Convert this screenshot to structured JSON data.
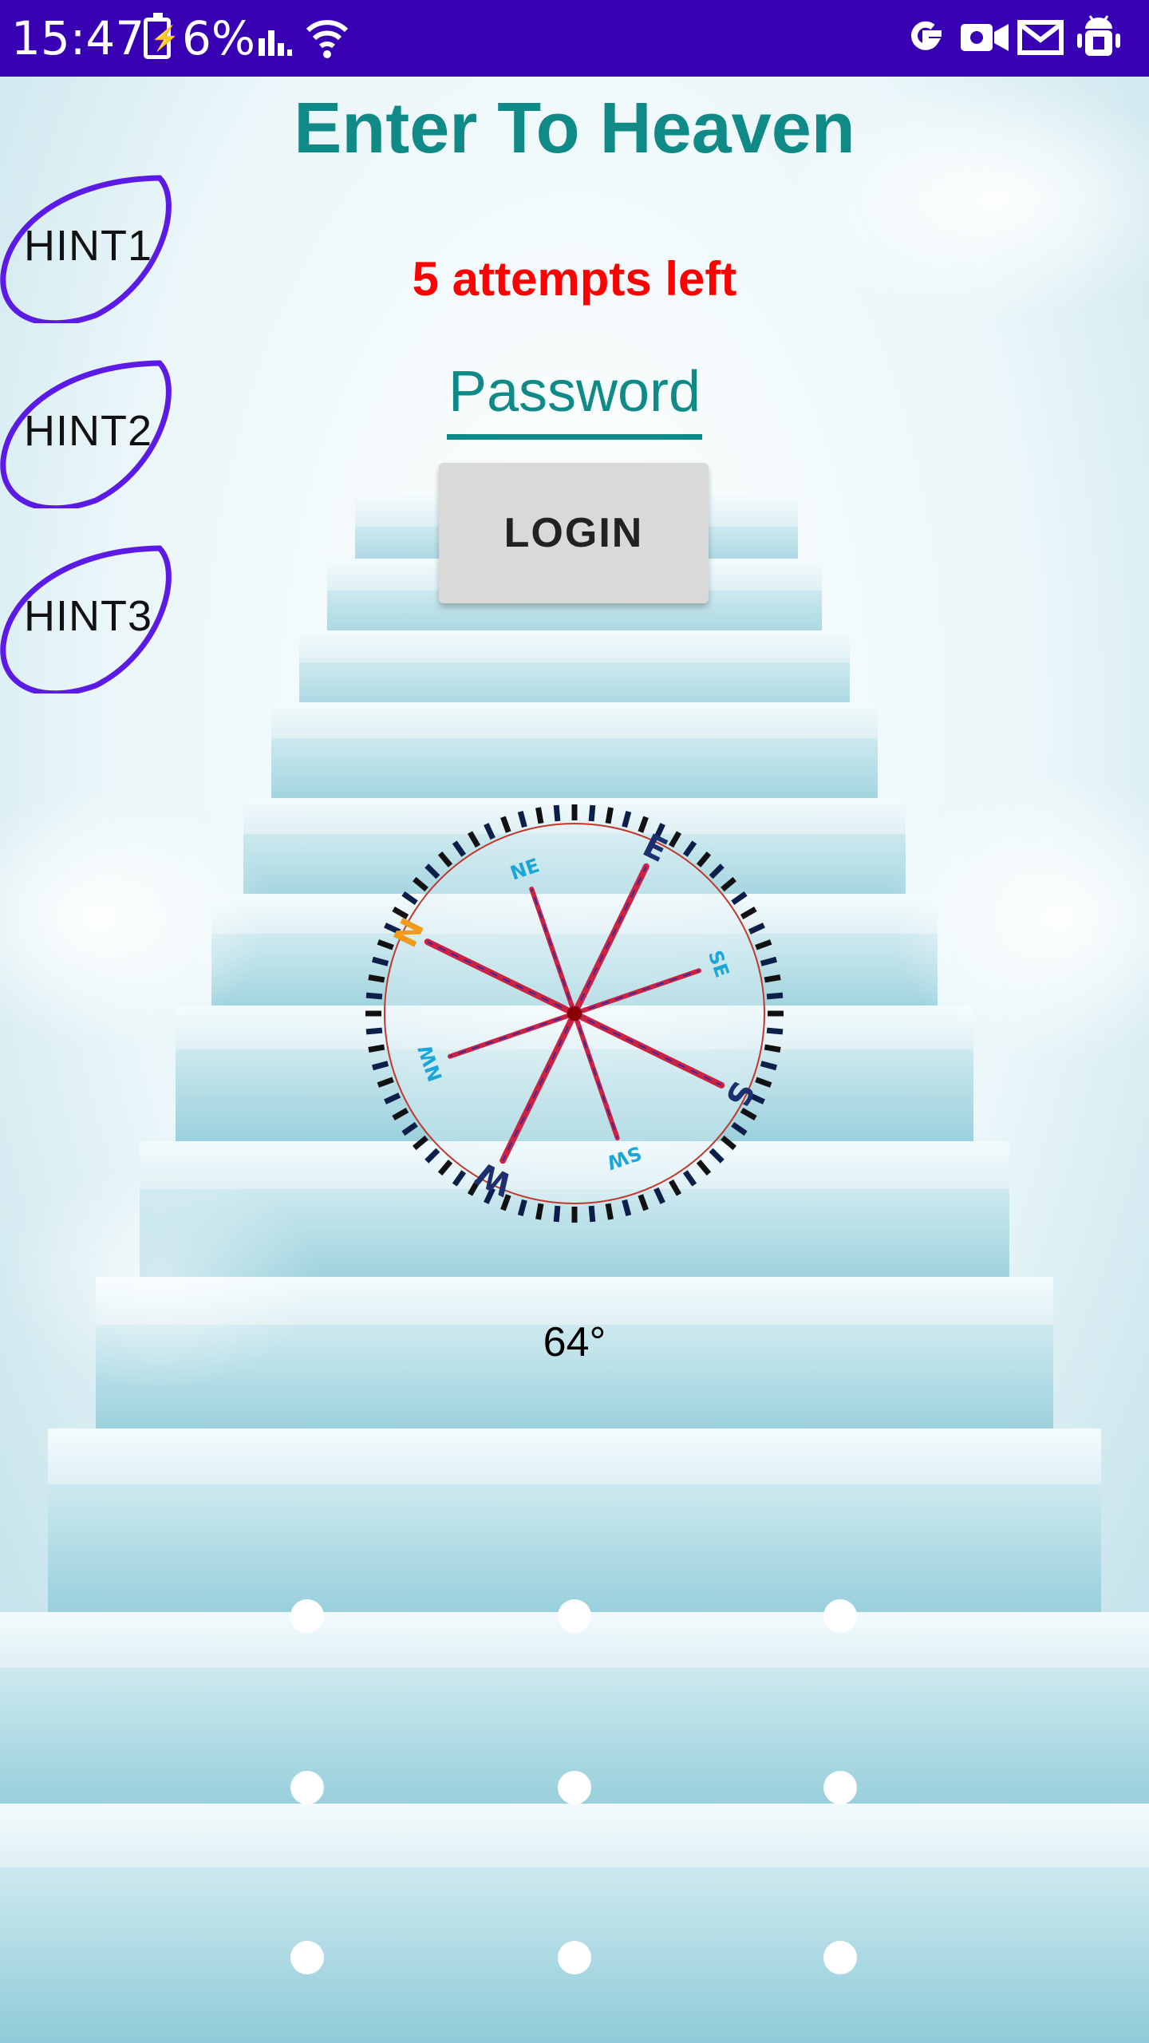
{
  "status_bar": {
    "time": "15:47",
    "battery_percent": "6%",
    "icons": [
      "battery-charging-icon",
      "signal-icon",
      "wifi-icon",
      "google-icon",
      "video-camera-icon",
      "gmail-icon",
      "android-debug-icon"
    ]
  },
  "app": {
    "title": "Enter To Heaven",
    "attempts_text": "5 attempts left",
    "password_placeholder": "Password",
    "login_label": "LOGIN",
    "hints": [
      "HINT1",
      "HINT2",
      "HINT3"
    ]
  },
  "compass": {
    "heading_text": "64°",
    "heading_degrees": 64,
    "labels": [
      "N",
      "NE",
      "E",
      "SE",
      "S",
      "SW",
      "W",
      "NW"
    ]
  },
  "pattern_lock": {
    "rows": 3,
    "cols": 3
  },
  "colors": {
    "status_bar": "#3700b3",
    "title": "#0f8a86",
    "attempts": "#ff0000",
    "hint_outline": "#5b1ae6",
    "needle": "#cc2244"
  }
}
